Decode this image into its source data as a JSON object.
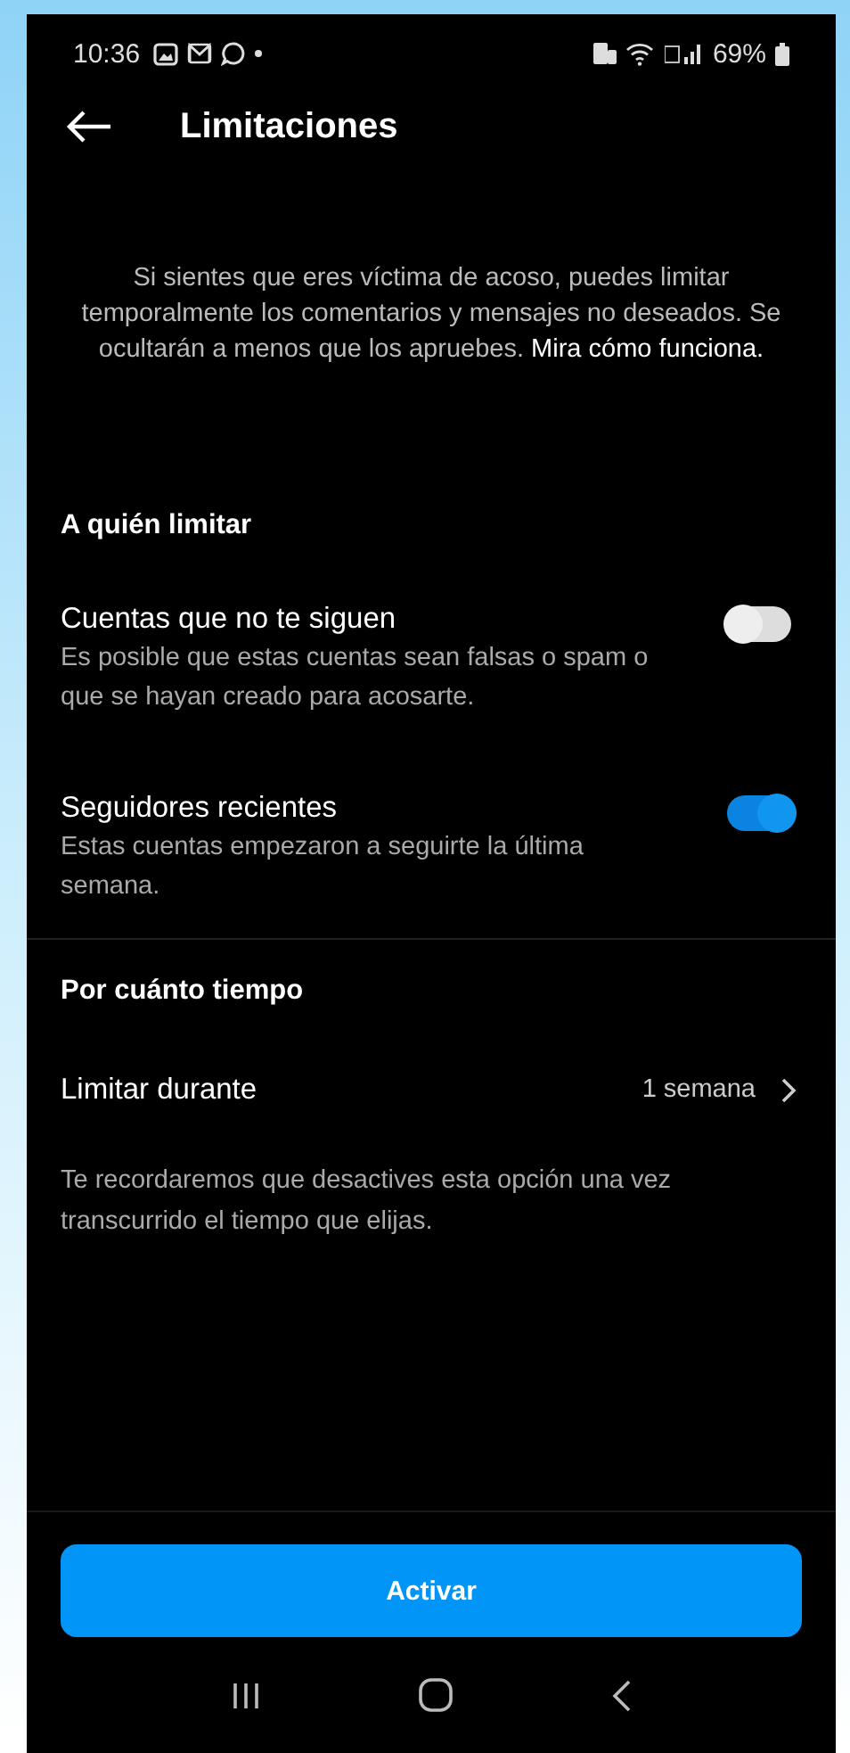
{
  "status_bar": {
    "time": "10:36",
    "battery": "69%"
  },
  "header": {
    "title": "Limitaciones"
  },
  "intro": {
    "text": "Si sientes que eres víctima de acoso, puedes limitar temporalmente los comentarios y mensajes no deseados. Se ocultarán a menos que los apruebes.",
    "link": "Mira cómo funciona."
  },
  "who_section": {
    "title": "A quién limitar",
    "options": [
      {
        "title": "Cuentas que no te siguen",
        "description": "Es posible que estas cuentas sean falsas o spam o que se hayan creado para acosarte.",
        "on": false
      },
      {
        "title": "Seguidores recientes",
        "description": "Estas cuentas empezaron a seguirte la última semana.",
        "on": true
      }
    ]
  },
  "duration_section": {
    "title": "Por cuánto tiempo",
    "row": {
      "label": "Limitar durante",
      "value": "1 semana"
    },
    "note": "Te recordaremos que desactives esta opción una vez transcurrido el tiempo que elijas."
  },
  "primary_button": "Activar"
}
